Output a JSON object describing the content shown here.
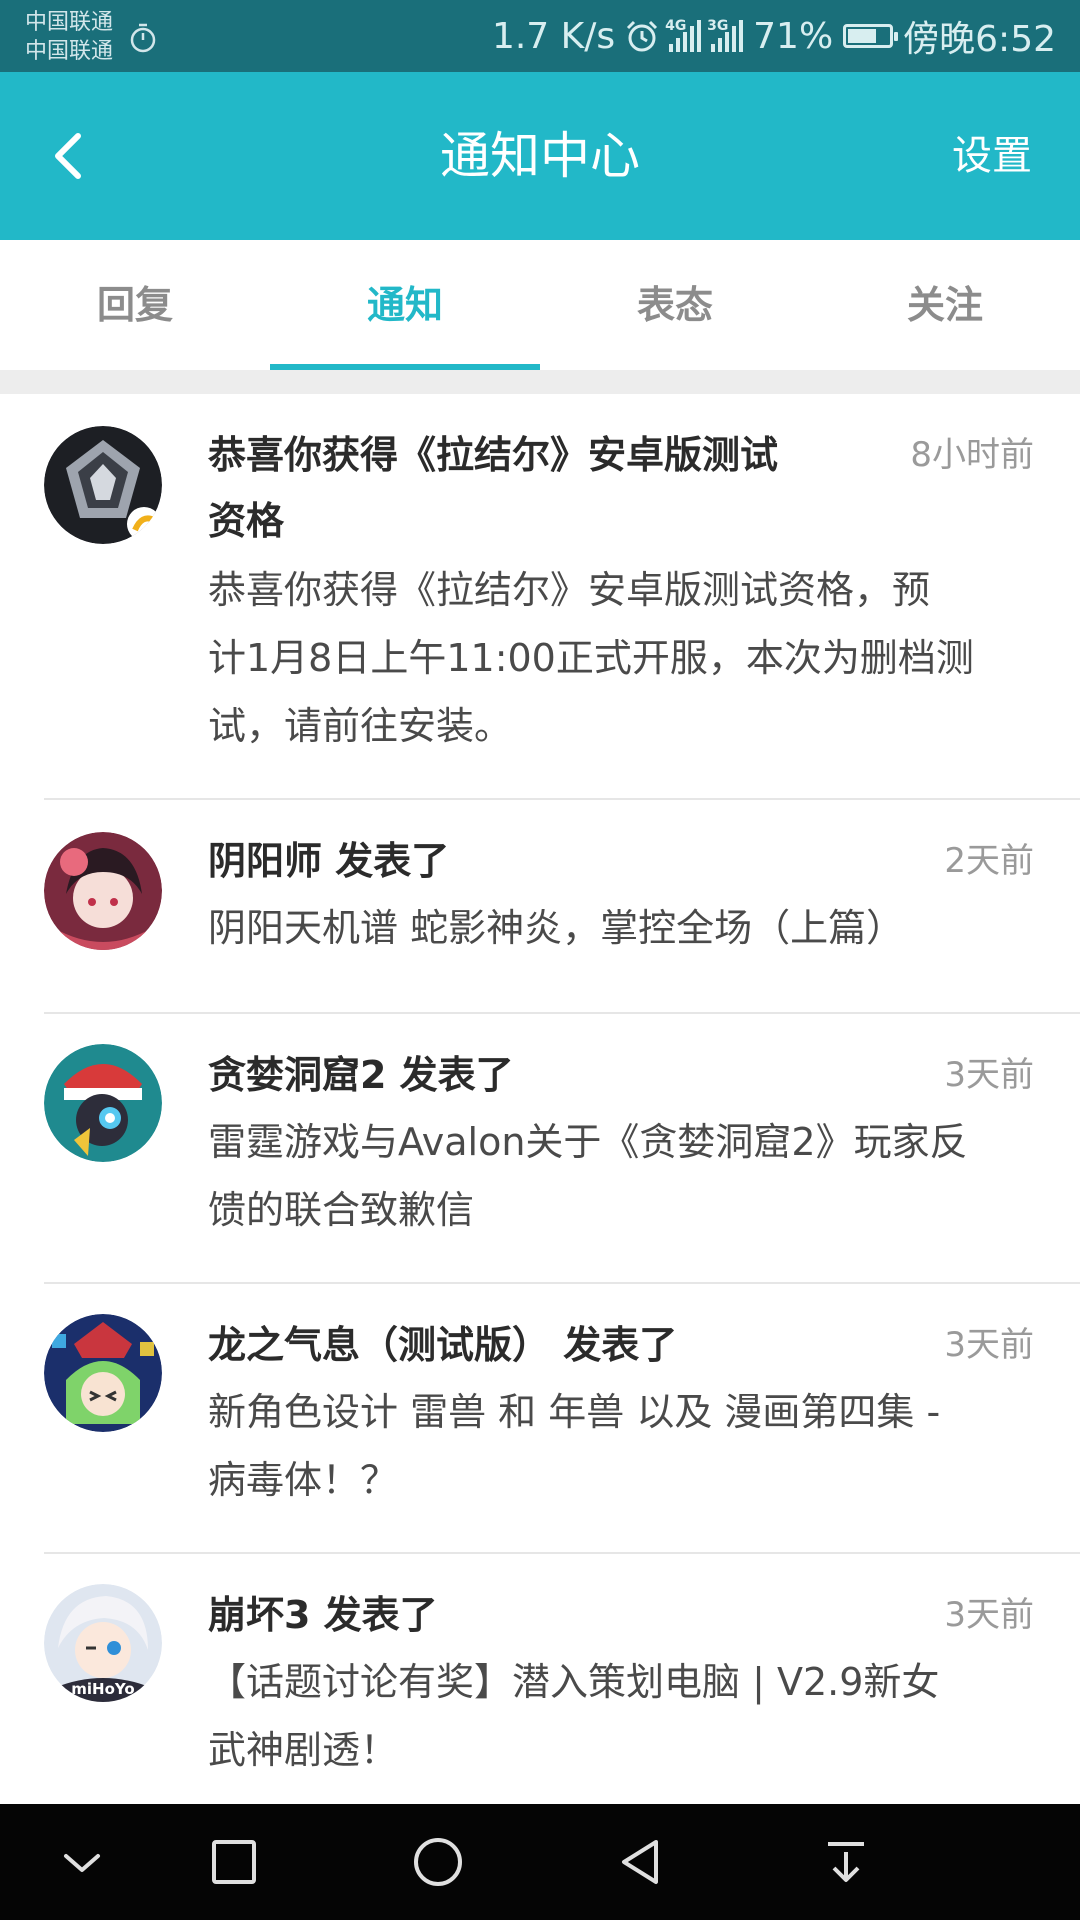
{
  "status_bar": {
    "carrier_1": "中国联通",
    "carrier_2": "中国联通",
    "net_speed": "1.7 K/s",
    "sig1_type": "4G",
    "sig2_type": "3G",
    "battery": "71%",
    "battery_level": 0.71,
    "time": "傍晚6:52",
    "icons": [
      "stopwatch-icon",
      "alarm-icon",
      "signal-4g-icon",
      "signal-3g-icon",
      "battery-icon"
    ]
  },
  "app_bar": {
    "title": "通知中心",
    "settings_label": "设置",
    "back_icon": "chevron-left-icon"
  },
  "tabs": [
    {
      "label": "回复",
      "active": false
    },
    {
      "label": "通知",
      "active": true
    },
    {
      "label": "表态",
      "active": false
    },
    {
      "label": "关注",
      "active": false
    }
  ],
  "notifications": [
    {
      "avatar": "lajieer-game-avatar",
      "title_line1": "恭喜你获得《拉结尔》安卓版测试",
      "title_line2": "资格",
      "time": "8小时前",
      "body_lines": [
        "恭喜你获得《拉结尔》安卓版测试资格，预",
        "计1月8日上午11:00正式开服，本次为删档测",
        "试，请前往安装。"
      ]
    },
    {
      "avatar": "onmyoji-avatar",
      "title_line1": "阴阳师 发表了",
      "time": "2天前",
      "body_lines": [
        "阴阳天机谱 蛇影神炎，掌控全场（上篇）"
      ]
    },
    {
      "avatar": "tanlan-dongku-avatar",
      "title_line1": "贪婪洞窟2 发表了",
      "time": "3天前",
      "body_lines": [
        "雷霆游戏与Avalon关于《贪婪洞窟2》玩家反",
        "馈的联合致歉信"
      ]
    },
    {
      "avatar": "dragon-breath-avatar",
      "title_line1": "龙之气息（测试版） 发表了",
      "time": "3天前",
      "body_lines": [
        "新角色设计 雷兽 和 年兽 以及 漫画第四集 -",
        "病毒体！？"
      ]
    },
    {
      "avatar": "honkai3-avatar",
      "avatar_text": "miHoYo",
      "title_line1": "崩坏3 发表了",
      "time": "3天前",
      "body_lines": [
        "【话题讨论有奖】潜入策划电脑 | V2.9新女",
        "武神剧透！"
      ]
    }
  ],
  "nav_bar": {
    "buttons": [
      "hide-bar-icon",
      "recents-icon",
      "home-icon",
      "back-icon",
      "notification-pull-icon"
    ]
  },
  "colors": {
    "accent": "#22b8c8",
    "status_bar": "#1a6f7a",
    "nav_bar": "#050505"
  }
}
